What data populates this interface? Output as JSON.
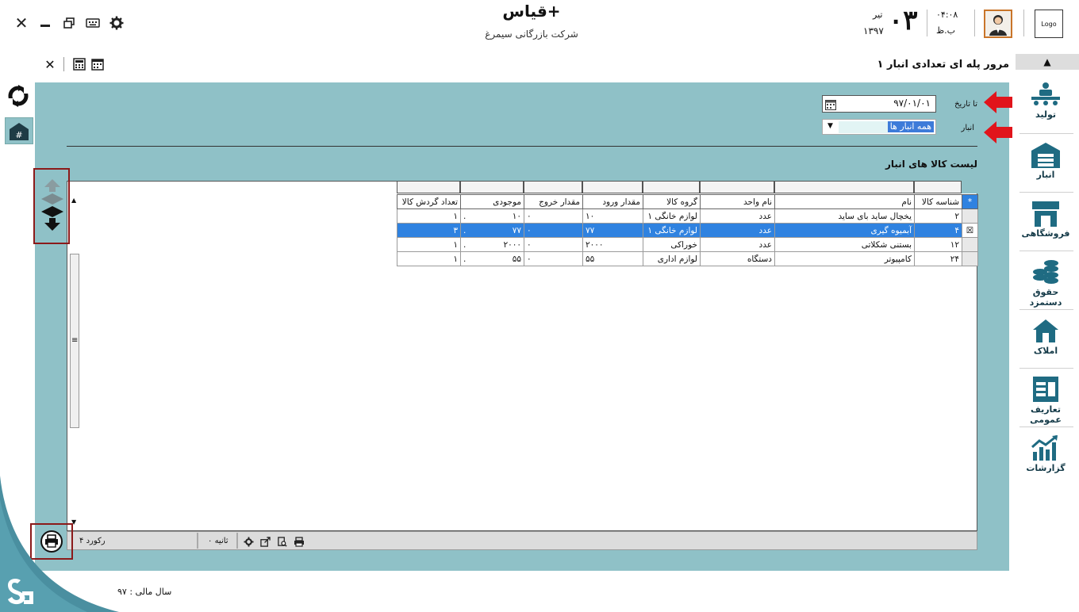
{
  "app": {
    "title": "قیاس+",
    "company": "شرکت بازرگانی سیمرغ",
    "date_day": "۰۳",
    "date_month": "تیر",
    "date_year": "۱۳۹۷",
    "time": "۰۴:۰۸",
    "ampm": "ب.ظ",
    "logo_text": "Logo"
  },
  "window_controls": [
    "close",
    "minimize",
    "restore",
    "keyboard",
    "settings"
  ],
  "page": {
    "title": "مرور پله ای تعدادی انبار ۱"
  },
  "filters": {
    "to_date_label": "تا تاریخ",
    "to_date_value": "۹۷/۰۱/۰۱",
    "warehouse_label": "انبار",
    "warehouse_value": "همه انبار ها"
  },
  "grid": {
    "title": "لیست کالا های انبار",
    "columns": [
      "شناسه کالا",
      "نام",
      "نام واحد",
      "گروه کالا",
      "مقدار ورود",
      "مقدار خروج",
      "موجودی",
      "تعداد گردش کالا"
    ],
    "rows": [
      {
        "id": "۲",
        "name": "یخچال ساید بای ساید",
        "unit": "عدد",
        "group": "لوازم خانگی ۱",
        "in": "۱۰",
        "out": "۰",
        "stock": "۱۰",
        "turns": "۱"
      },
      {
        "id": "۴",
        "name": "آبمیوه گیری",
        "unit": "عدد",
        "group": "لوازم خانگی ۱",
        "in": "۷۷",
        "out": "۰",
        "stock": "۷۷",
        "turns": "۳"
      },
      {
        "id": "۱۲",
        "name": "بستنی شکلاتی",
        "unit": "عدد",
        "group": "خوراکی",
        "in": "۲۰۰۰",
        "out": "۰",
        "stock": "۲۰۰۰",
        "turns": "۱"
      },
      {
        "id": "۲۴",
        "name": "کامپیوتر",
        "unit": "دستگاه",
        "group": "لوازم اداری",
        "in": "۵۵",
        "out": "۰",
        "stock": "۵۵",
        "turns": "۱"
      }
    ],
    "selected_row_index": 1
  },
  "status": {
    "records": "۴ رکورد",
    "seconds": "۰ ثانیه"
  },
  "footer": {
    "fiscal_year": "سال مالی : ۹۷"
  },
  "nav": {
    "items": [
      {
        "label": "تولید",
        "icon": "production-icon"
      },
      {
        "label": "انبار",
        "icon": "warehouse-icon"
      },
      {
        "label": "فروشگاهی",
        "icon": "store-icon"
      },
      {
        "label": "حقوق دستمزد",
        "icon": "coins-icon"
      },
      {
        "label": "املاک",
        "icon": "house-icon"
      },
      {
        "label": "تعاریف عمومی",
        "icon": "definitions-icon"
      },
      {
        "label": "گزارشات",
        "icon": "reports-icon"
      }
    ]
  },
  "colors": {
    "panel": "#8fc1c7",
    "selection": "#2f82e0",
    "accent_red": "#e1141b",
    "nav_icon": "#1f6b82",
    "highlight_box": "#8b1a1a"
  }
}
